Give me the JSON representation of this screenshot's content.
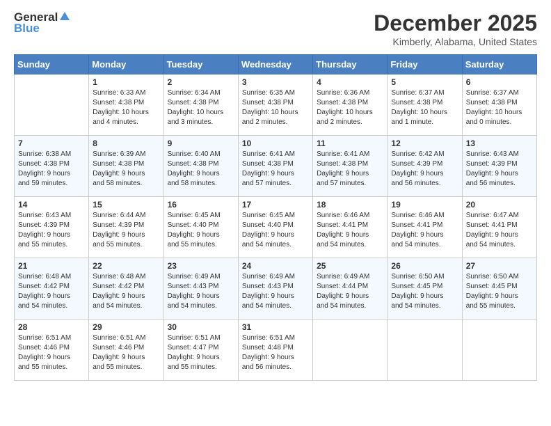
{
  "logo": {
    "general": "General",
    "blue": "Blue"
  },
  "title": "December 2025",
  "location": "Kimberly, Alabama, United States",
  "weekdays": [
    "Sunday",
    "Monday",
    "Tuesday",
    "Wednesday",
    "Thursday",
    "Friday",
    "Saturday"
  ],
  "weeks": [
    [
      {
        "day": "",
        "info": ""
      },
      {
        "day": "1",
        "info": "Sunrise: 6:33 AM\nSunset: 4:38 PM\nDaylight: 10 hours\nand 4 minutes."
      },
      {
        "day": "2",
        "info": "Sunrise: 6:34 AM\nSunset: 4:38 PM\nDaylight: 10 hours\nand 3 minutes."
      },
      {
        "day": "3",
        "info": "Sunrise: 6:35 AM\nSunset: 4:38 PM\nDaylight: 10 hours\nand 2 minutes."
      },
      {
        "day": "4",
        "info": "Sunrise: 6:36 AM\nSunset: 4:38 PM\nDaylight: 10 hours\nand 2 minutes."
      },
      {
        "day": "5",
        "info": "Sunrise: 6:37 AM\nSunset: 4:38 PM\nDaylight: 10 hours\nand 1 minute."
      },
      {
        "day": "6",
        "info": "Sunrise: 6:37 AM\nSunset: 4:38 PM\nDaylight: 10 hours\nand 0 minutes."
      }
    ],
    [
      {
        "day": "7",
        "info": "Sunrise: 6:38 AM\nSunset: 4:38 PM\nDaylight: 9 hours\nand 59 minutes."
      },
      {
        "day": "8",
        "info": "Sunrise: 6:39 AM\nSunset: 4:38 PM\nDaylight: 9 hours\nand 58 minutes."
      },
      {
        "day": "9",
        "info": "Sunrise: 6:40 AM\nSunset: 4:38 PM\nDaylight: 9 hours\nand 58 minutes."
      },
      {
        "day": "10",
        "info": "Sunrise: 6:41 AM\nSunset: 4:38 PM\nDaylight: 9 hours\nand 57 minutes."
      },
      {
        "day": "11",
        "info": "Sunrise: 6:41 AM\nSunset: 4:38 PM\nDaylight: 9 hours\nand 57 minutes."
      },
      {
        "day": "12",
        "info": "Sunrise: 6:42 AM\nSunset: 4:39 PM\nDaylight: 9 hours\nand 56 minutes."
      },
      {
        "day": "13",
        "info": "Sunrise: 6:43 AM\nSunset: 4:39 PM\nDaylight: 9 hours\nand 56 minutes."
      }
    ],
    [
      {
        "day": "14",
        "info": "Sunrise: 6:43 AM\nSunset: 4:39 PM\nDaylight: 9 hours\nand 55 minutes."
      },
      {
        "day": "15",
        "info": "Sunrise: 6:44 AM\nSunset: 4:39 PM\nDaylight: 9 hours\nand 55 minutes."
      },
      {
        "day": "16",
        "info": "Sunrise: 6:45 AM\nSunset: 4:40 PM\nDaylight: 9 hours\nand 55 minutes."
      },
      {
        "day": "17",
        "info": "Sunrise: 6:45 AM\nSunset: 4:40 PM\nDaylight: 9 hours\nand 54 minutes."
      },
      {
        "day": "18",
        "info": "Sunrise: 6:46 AM\nSunset: 4:41 PM\nDaylight: 9 hours\nand 54 minutes."
      },
      {
        "day": "19",
        "info": "Sunrise: 6:46 AM\nSunset: 4:41 PM\nDaylight: 9 hours\nand 54 minutes."
      },
      {
        "day": "20",
        "info": "Sunrise: 6:47 AM\nSunset: 4:41 PM\nDaylight: 9 hours\nand 54 minutes."
      }
    ],
    [
      {
        "day": "21",
        "info": "Sunrise: 6:48 AM\nSunset: 4:42 PM\nDaylight: 9 hours\nand 54 minutes."
      },
      {
        "day": "22",
        "info": "Sunrise: 6:48 AM\nSunset: 4:42 PM\nDaylight: 9 hours\nand 54 minutes."
      },
      {
        "day": "23",
        "info": "Sunrise: 6:49 AM\nSunset: 4:43 PM\nDaylight: 9 hours\nand 54 minutes."
      },
      {
        "day": "24",
        "info": "Sunrise: 6:49 AM\nSunset: 4:43 PM\nDaylight: 9 hours\nand 54 minutes."
      },
      {
        "day": "25",
        "info": "Sunrise: 6:49 AM\nSunset: 4:44 PM\nDaylight: 9 hours\nand 54 minutes."
      },
      {
        "day": "26",
        "info": "Sunrise: 6:50 AM\nSunset: 4:45 PM\nDaylight: 9 hours\nand 54 minutes."
      },
      {
        "day": "27",
        "info": "Sunrise: 6:50 AM\nSunset: 4:45 PM\nDaylight: 9 hours\nand 55 minutes."
      }
    ],
    [
      {
        "day": "28",
        "info": "Sunrise: 6:51 AM\nSunset: 4:46 PM\nDaylight: 9 hours\nand 55 minutes."
      },
      {
        "day": "29",
        "info": "Sunrise: 6:51 AM\nSunset: 4:46 PM\nDaylight: 9 hours\nand 55 minutes."
      },
      {
        "day": "30",
        "info": "Sunrise: 6:51 AM\nSunset: 4:47 PM\nDaylight: 9 hours\nand 55 minutes."
      },
      {
        "day": "31",
        "info": "Sunrise: 6:51 AM\nSunset: 4:48 PM\nDaylight: 9 hours\nand 56 minutes."
      },
      {
        "day": "",
        "info": ""
      },
      {
        "day": "",
        "info": ""
      },
      {
        "day": "",
        "info": ""
      }
    ]
  ]
}
